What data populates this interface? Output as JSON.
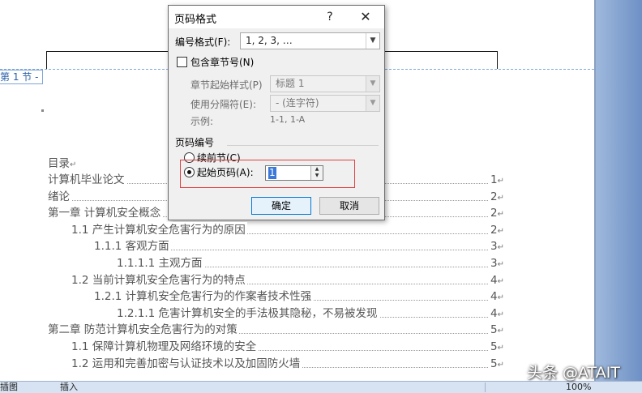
{
  "document": {
    "section_tag": "第 1 节 -",
    "toc_title": "目录",
    "para_mark": "↵",
    "toc": [
      {
        "text": "计算机毕业论文",
        "page": "1",
        "level": 0
      },
      {
        "text": "绪论",
        "page": "2",
        "level": 0
      },
      {
        "text": "第一章  计算机安全概念",
        "page": "2",
        "level": 0
      },
      {
        "text": "1.1  产生计算机安全危害行为的原因",
        "page": "2",
        "level": 1
      },
      {
        "text": "1.1.1  客观方面",
        "page": "3",
        "level": 2
      },
      {
        "text": "1.1.1.1  主观方面",
        "page": "3",
        "level": 3
      },
      {
        "text": "1.2  当前计算机安全危害行为的特点",
        "page": "4",
        "level": 1
      },
      {
        "text": "1.2.1  计算机安全危害行为的作案者技术性强",
        "page": "4",
        "level": 2
      },
      {
        "text": "1.2.1.1  危害计算机安全的手法极其隐秘，不易被发现",
        "page": "4",
        "level": 3
      },
      {
        "text": "第二章  防范计算机安全危害行为的对策",
        "page": "5",
        "level": 0
      },
      {
        "text": "1.1  保障计算机物理及网络环境的安全",
        "page": "5",
        "level": 1
      },
      {
        "text": "1.2  运用和完善加密与认证技术以及加固防火墙",
        "page": "5",
        "level": 1
      }
    ]
  },
  "dialog": {
    "title": "页码格式",
    "help": "?",
    "close": "✕",
    "number_format_label": "编号格式(F):",
    "number_format_value": "1, 2, 3, …",
    "include_chapter_label": "包含章节号(N)",
    "chapter_style_label": "章节起始样式(P)",
    "chapter_style_value": "标题 1",
    "separator_label": "使用分隔符(E):",
    "separator_value": "-  (连字符)",
    "example_label": "示例:",
    "example_value": "1-1, 1-A",
    "page_numbering_label": "页码编号",
    "continue_label": "续前节(C)",
    "start_at_label": "起始页码(A):",
    "start_at_value": "1",
    "ok_label": "确定",
    "cancel_label": "取消"
  },
  "status_bar": {
    "left": "插图",
    "mode": "插入",
    "zoom": "100%"
  },
  "watermark": "头条 @ATAIT"
}
